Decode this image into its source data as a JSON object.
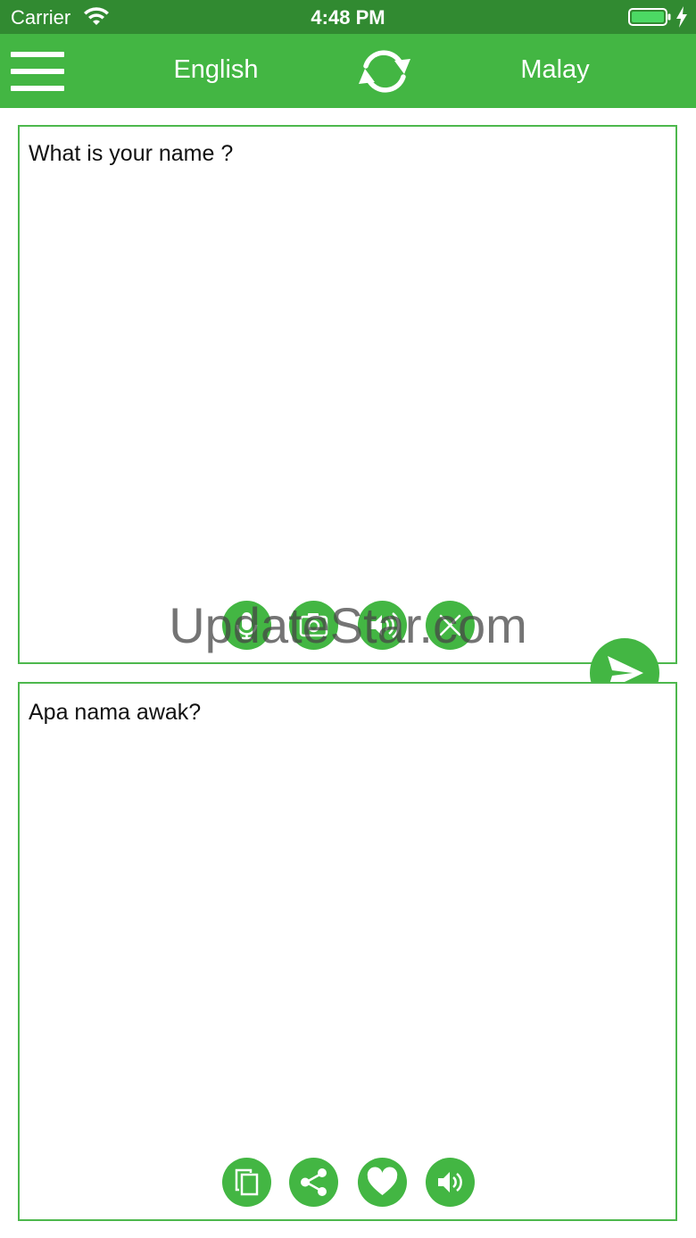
{
  "status_bar": {
    "carrier": "Carrier",
    "time": "4:48 PM",
    "battery_color": "#4cd964"
  },
  "nav": {
    "background_color": "#43b643",
    "source_language": "English",
    "target_language": "Malay",
    "icons": {
      "menu": "hamburger-icon",
      "swap": "swap-arrows-icon"
    }
  },
  "source_panel": {
    "text": "What is your name ?",
    "actions": [
      {
        "name": "microphone",
        "icon": "microphone-icon"
      },
      {
        "name": "camera",
        "icon": "camera-icon"
      },
      {
        "name": "speak-slow",
        "icon": "speaker-icon"
      },
      {
        "name": "clear",
        "icon": "close-icon"
      }
    ]
  },
  "target_panel": {
    "text": "Apa nama awak?",
    "actions": [
      {
        "name": "copy",
        "icon": "copy-icon"
      },
      {
        "name": "share",
        "icon": "share-icon"
      },
      {
        "name": "favorite",
        "icon": "heart-icon"
      },
      {
        "name": "speak",
        "icon": "speaker-icon"
      }
    ]
  },
  "send": {
    "icon": "send-icon"
  },
  "watermark": "UpdateStar.com",
  "colors": {
    "accent": "#43b643",
    "status_bar": "#318a31",
    "panel_border": "#4db84d"
  }
}
